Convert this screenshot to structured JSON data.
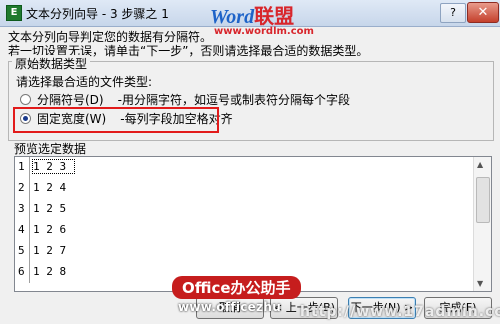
{
  "window": {
    "title": "文本分列向导 - 3 步骤之 1",
    "help_label": "?",
    "close_label": "✕"
  },
  "brand": {
    "word": "Word",
    "lianmeng": "联盟",
    "url": "www.wordlm.com"
  },
  "intro": {
    "line1": "文本分列向导判定您的数据有分隔符。",
    "line2": "若一切设置无误，请单击“下一步”，否则请选择最合适的数据类型。"
  },
  "group": {
    "title": "原始数据类型",
    "prompt": "请选择最合适的文件类型:",
    "options": [
      {
        "label": "分隔符号(D)",
        "desc": "-用分隔字符，如逗号或制表符分隔每个字段",
        "selected": false
      },
      {
        "label": "固定宽度(W)",
        "desc": "-每列字段加空格对齐",
        "selected": true
      }
    ]
  },
  "preview": {
    "label": "预览选定数据",
    "rows": [
      {
        "num": "1",
        "value": "1 2 3"
      },
      {
        "num": "2",
        "value": "1 2 4"
      },
      {
        "num": "3",
        "value": "1 2 5"
      },
      {
        "num": "4",
        "value": "1 2 6"
      },
      {
        "num": "5",
        "value": "1 2 7"
      },
      {
        "num": "6",
        "value": "1 2 8"
      }
    ]
  },
  "watermark": {
    "label": "Office办公助手",
    "url_left": "www.officezhu",
    "url_right": "http://www.17admin.co"
  },
  "buttons": {
    "cancel": "取消",
    "back": "< 上一步(B)",
    "next": "下一步(N) >",
    "finish": "完成(F)"
  }
}
